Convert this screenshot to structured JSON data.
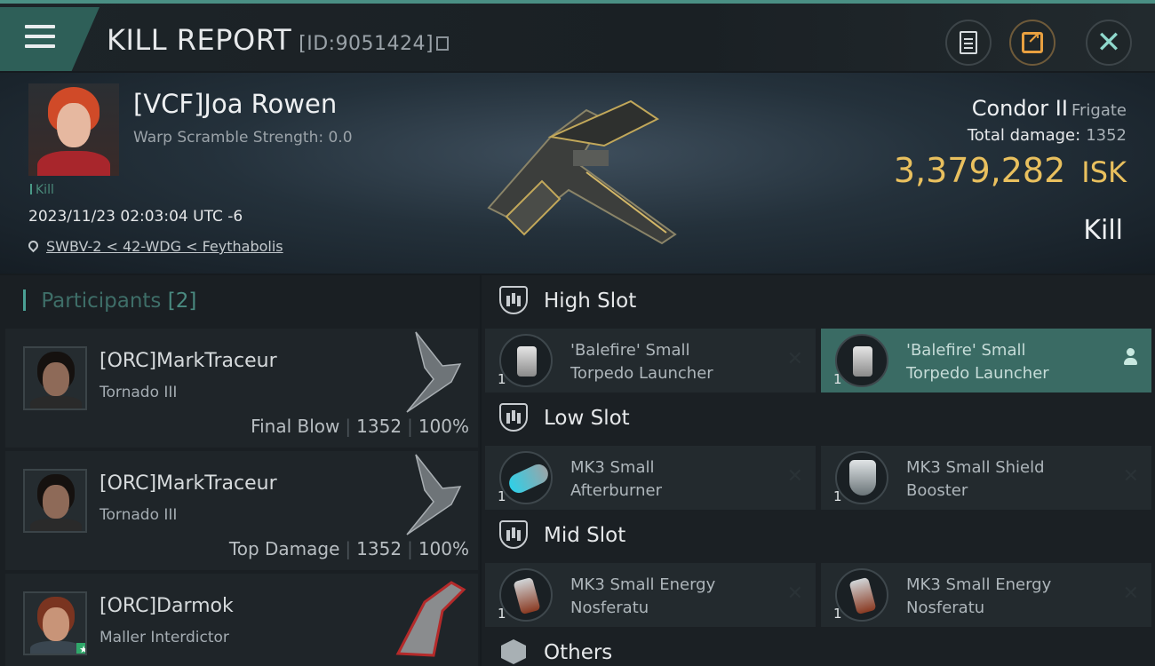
{
  "header": {
    "title": "KILL REPORT",
    "report_id": "[ID:9051424]"
  },
  "victim": {
    "name": "[VCF]Joa Rowen",
    "warp_scramble": "Warp Scramble Strength: 0.0",
    "tag": "Kill",
    "datetime": "2023/11/23 02:03:04 UTC -6",
    "location": "SWBV-2 < 42-WDG < Feythabolis",
    "ship_name": "Condor II",
    "ship_class": "Frigate",
    "total_damage_label": "Total damage:",
    "total_damage": "1352",
    "isk_value": "3,379,282",
    "isk_unit": "ISK",
    "outcome": "Kill"
  },
  "participants": {
    "label": "Participants",
    "count": "[2]",
    "rows": [
      {
        "name": "[ORC]MarkTraceur",
        "ship": "Tornado III",
        "role": "Final Blow",
        "damage": "1352",
        "percent": "100%"
      },
      {
        "name": "[ORC]MarkTraceur",
        "ship": "Tornado III",
        "role": "Top Damage",
        "damage": "1352",
        "percent": "100%"
      },
      {
        "name": "[ORC]Darmok",
        "ship": "Maller Interdictor"
      }
    ]
  },
  "fittings": {
    "high": {
      "title": "High Slot",
      "items": [
        {
          "line1": "'Balefire' Small",
          "line2": "Torpedo Launcher",
          "qty": "1"
        },
        {
          "line1": "'Balefire' Small",
          "line2": "Torpedo Launcher",
          "qty": "1"
        }
      ]
    },
    "low": {
      "title": "Low Slot",
      "items": [
        {
          "line1": "MK3 Small",
          "line2": "Afterburner",
          "qty": "1"
        },
        {
          "line1": "MK3 Small Shield",
          "line2": "Booster",
          "qty": "1"
        }
      ]
    },
    "mid": {
      "title": "Mid Slot",
      "items": [
        {
          "line1": "MK3 Small Energy",
          "line2": "Nosferatu",
          "qty": "1"
        },
        {
          "line1": "MK3 Small Energy",
          "line2": "Nosferatu",
          "qty": "1"
        }
      ]
    },
    "others": {
      "title": "Others"
    }
  },
  "icons": {
    "close": "✕",
    "remove": "✕"
  },
  "colors": {
    "accent": "#4aa094",
    "isk": "#e9c05e",
    "selected_slot": "#3a6b64"
  }
}
